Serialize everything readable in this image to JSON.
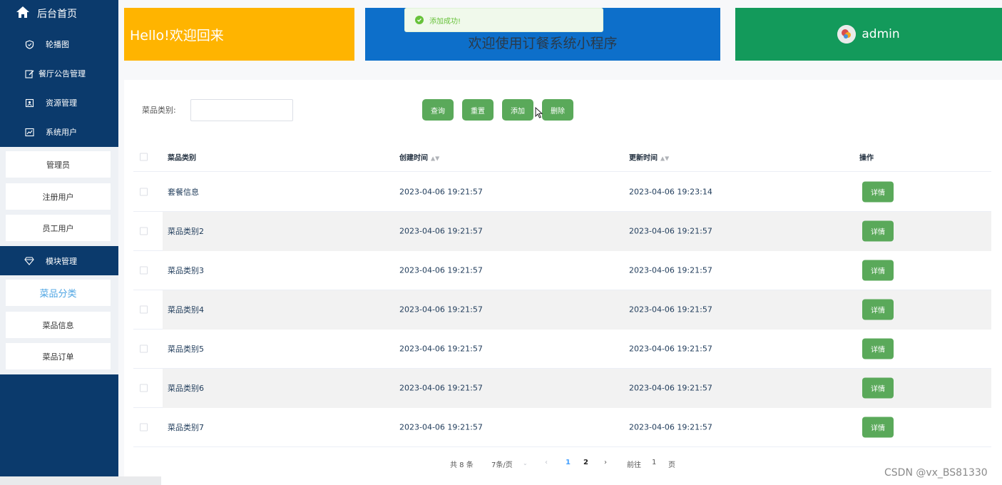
{
  "sidebar": {
    "home": "后台首页",
    "items": [
      {
        "label": "轮播图",
        "icon": "shield-icon"
      },
      {
        "label": "餐厅公告管理",
        "icon": "edit-icon"
      },
      {
        "label": "资源管理",
        "icon": "image-icon"
      },
      {
        "label": "系统用户",
        "icon": "chart-icon"
      }
    ],
    "user_sub": [
      "管理员",
      "注册用户",
      "员工用户"
    ],
    "module": {
      "label": "模块管理",
      "icon": "diamond-icon"
    },
    "module_sub": [
      "菜品分类",
      "菜品信息",
      "菜品订单"
    ]
  },
  "cards": {
    "hello": "Hello!欢迎回来",
    "welcome": "欢迎使用订餐系统小程序",
    "user": "admin"
  },
  "toast": {
    "message": "添加成功!"
  },
  "search": {
    "label": "菜品类别:",
    "value": "",
    "placeholder": ""
  },
  "buttons": {
    "query": "查询",
    "reset": "重置",
    "add": "添加",
    "delete": "删除"
  },
  "table": {
    "headers": {
      "category": "菜品类别",
      "created": "创建时间",
      "updated": "更新时间",
      "action": "操作"
    },
    "detail_label": "详情",
    "rows": [
      {
        "category": "套餐信息",
        "created": "2023-04-06 19:21:57",
        "updated": "2023-04-06 19:23:14"
      },
      {
        "category": "菜品类别2",
        "created": "2023-04-06 19:21:57",
        "updated": "2023-04-06 19:21:57"
      },
      {
        "category": "菜品类别3",
        "created": "2023-04-06 19:21:57",
        "updated": "2023-04-06 19:21:57"
      },
      {
        "category": "菜品类别4",
        "created": "2023-04-06 19:21:57",
        "updated": "2023-04-06 19:21:57"
      },
      {
        "category": "菜品类别5",
        "created": "2023-04-06 19:21:57",
        "updated": "2023-04-06 19:21:57"
      },
      {
        "category": "菜品类别6",
        "created": "2023-04-06 19:21:57",
        "updated": "2023-04-06 19:21:57"
      },
      {
        "category": "菜品类别7",
        "created": "2023-04-06 19:21:57",
        "updated": "2023-04-06 19:21:57"
      }
    ]
  },
  "pagination": {
    "total": "共 8 条",
    "page_size": "7条/页",
    "pages": [
      "1",
      "2"
    ],
    "current_page": "1",
    "goto_prefix": "前往",
    "goto_value": "1",
    "goto_suffix": "页"
  },
  "watermark": "CSDN @vx_BS81330"
}
